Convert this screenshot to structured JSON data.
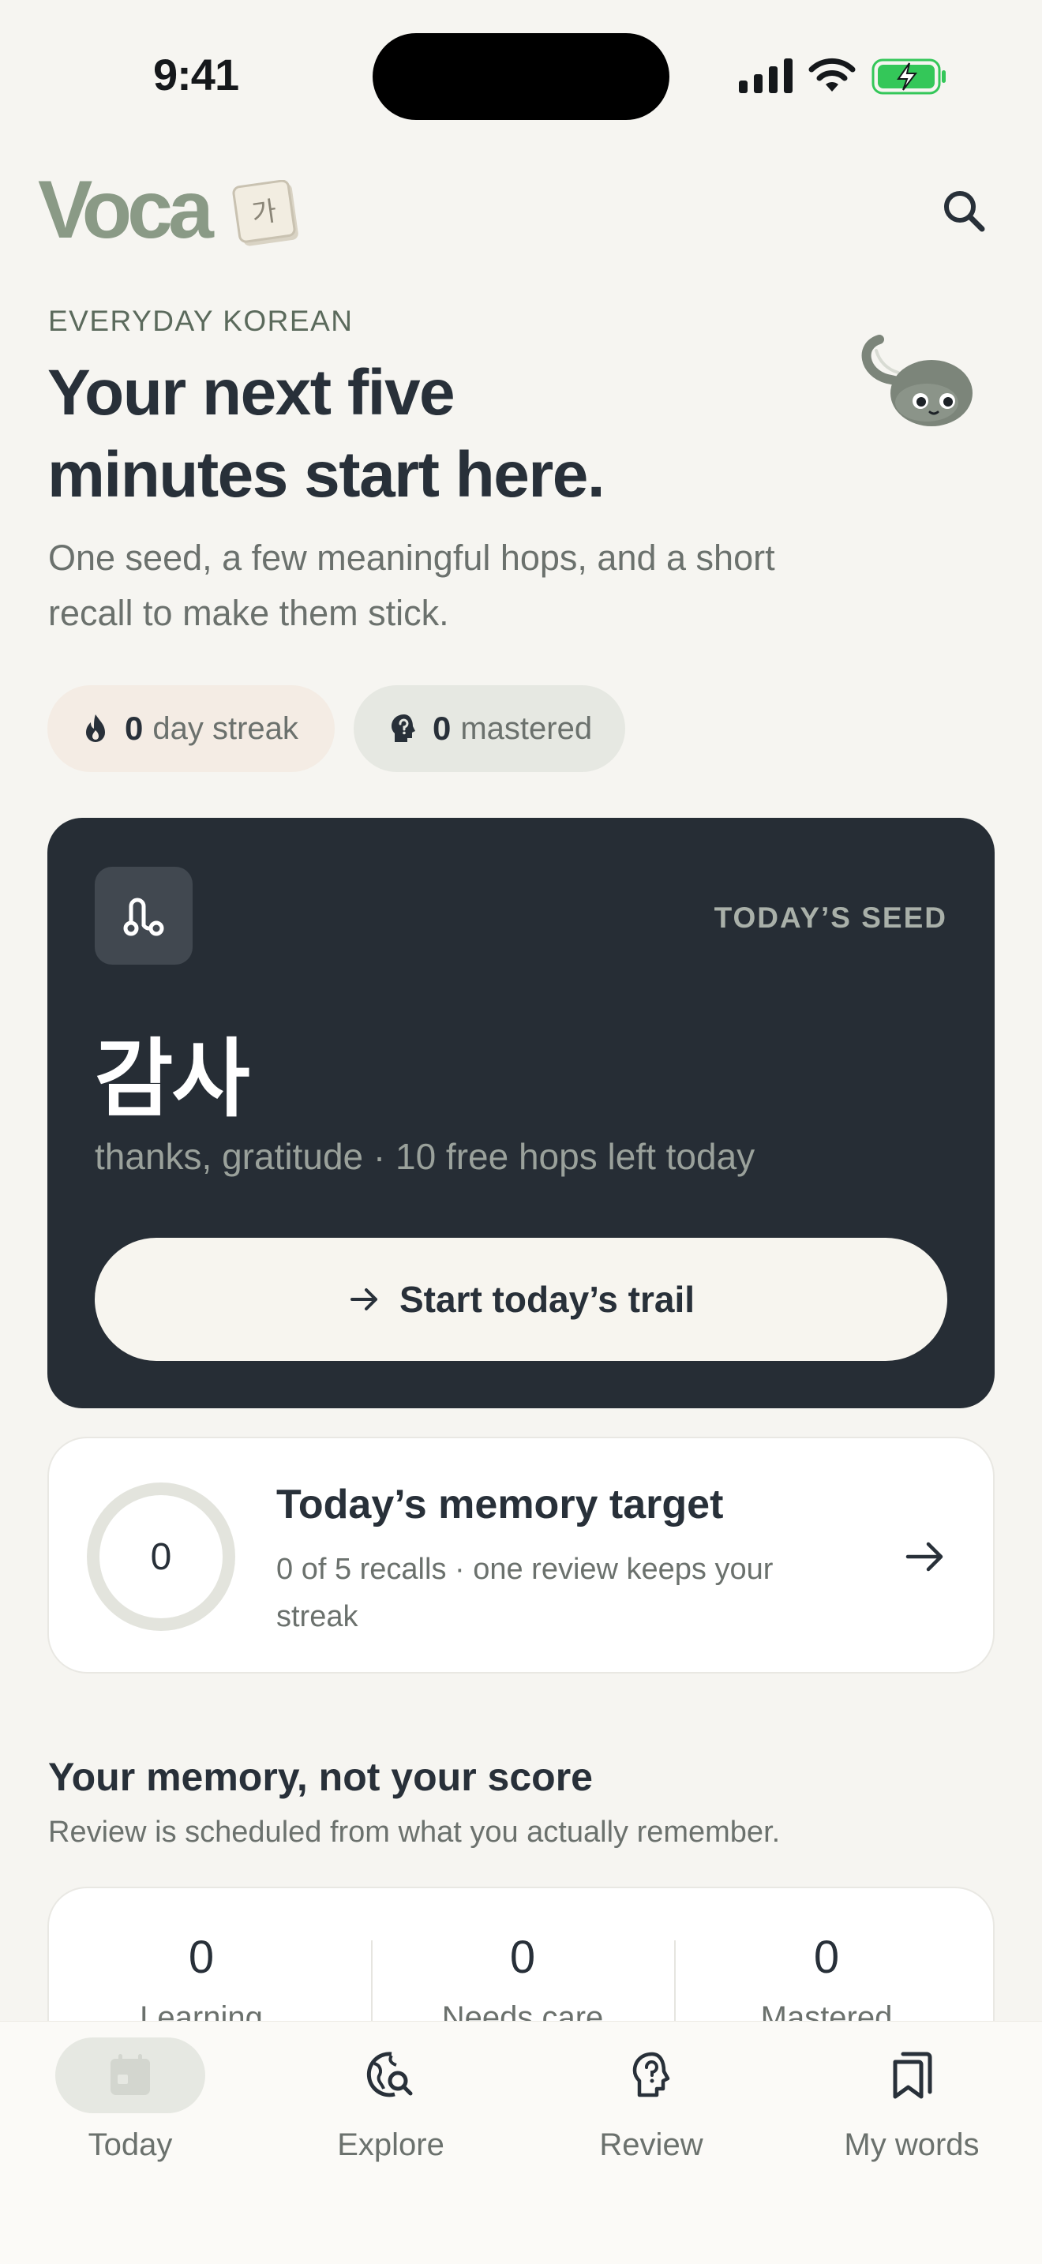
{
  "status_bar": {
    "time": "9:41"
  },
  "header": {
    "logo_text": "Voca",
    "logo_tile_char": "가"
  },
  "hero": {
    "eyebrow": "EVERYDAY KOREAN",
    "title_line1": "Your next five",
    "title_line2": "minutes start here.",
    "subtitle": "One seed, a few meaningful hops, and a short recall to make them stick."
  },
  "pills": {
    "streak": {
      "value": "0",
      "label": "day streak"
    },
    "mastered": {
      "value": "0",
      "label": "mastered"
    }
  },
  "seed": {
    "label": "TODAY’S SEED",
    "word": "감사",
    "meaning": "thanks, gratitude · 10 free hops left today",
    "cta": "Start today’s trail"
  },
  "target": {
    "progress_value": "0",
    "progress_fraction": 0,
    "title": "Today’s memory target",
    "subtitle": "0 of 5 recalls · one review keeps your streak"
  },
  "memory": {
    "title": "Your memory, not your score",
    "subtitle": "Review is scheduled from what you actually remember.",
    "stats": [
      {
        "value": "0",
        "label": "Learning"
      },
      {
        "value": "0",
        "label": "Needs care"
      },
      {
        "value": "0",
        "label": "Mastered"
      }
    ]
  },
  "tabs": [
    {
      "label": "Today",
      "icon": "calendar-icon",
      "active": true
    },
    {
      "label": "Explore",
      "icon": "globe-search-icon",
      "active": false
    },
    {
      "label": "Review",
      "icon": "head-question-icon",
      "active": false
    },
    {
      "label": "My words",
      "icon": "bookmarks-icon",
      "active": false
    }
  ],
  "colors": {
    "background": "#f6f5f1",
    "card_dark": "#262d35",
    "accent_sage": "#8a9a86",
    "text_primary": "#283039",
    "text_muted": "#6b716d"
  }
}
